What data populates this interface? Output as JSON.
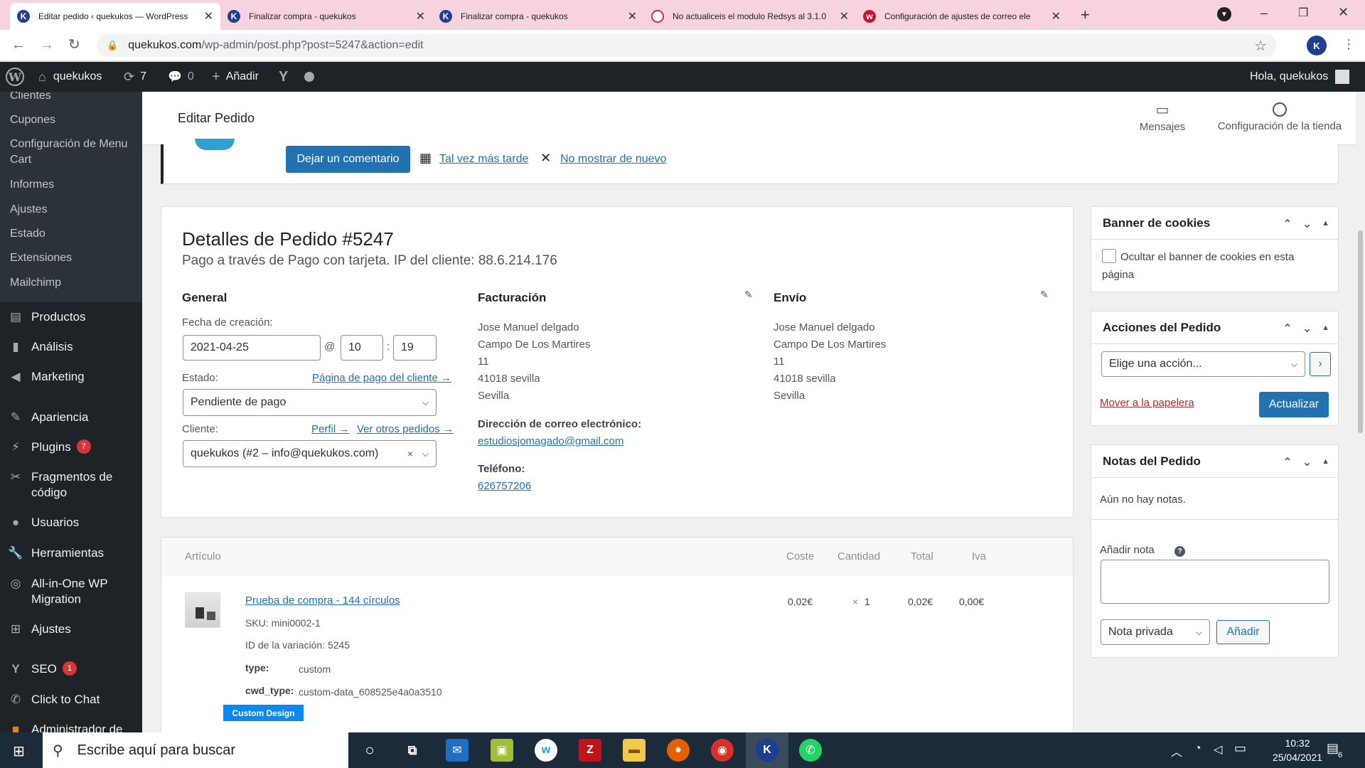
{
  "browser": {
    "tabs": [
      {
        "title": "Editar pedido ‹ quekukos — WordPress",
        "favicon": "K"
      },
      {
        "title": "Finalizar compra - quekukos",
        "favicon": "K"
      },
      {
        "title": "Finalizar compra - quekukos",
        "favicon": "K"
      },
      {
        "title": "No actualiceis el modulo Redsys al 3.1.0",
        "favicon": "R"
      },
      {
        "title": "Configuración de ajustes de correo ele",
        "favicon": "W"
      }
    ],
    "url_host": "quekukos.com",
    "url_path": "/wp-admin/post.php?post=5247&action=edit"
  },
  "adminbar": {
    "site": "quekukos",
    "updates": "7",
    "comments": "0",
    "add": "Añadir",
    "greeting": "Hola, quekukos"
  },
  "sidebar": {
    "sub_items": [
      "Clientes",
      "Cupones",
      "Configuración de Menu Cart",
      "Informes",
      "Ajustes",
      "Estado",
      "Extensiones",
      "Mailchimp"
    ],
    "items": [
      {
        "label": "Productos",
        "icon": "archive-icon"
      },
      {
        "label": "Análisis",
        "icon": "bar-chart-icon"
      },
      {
        "label": "Marketing",
        "icon": "megaphone-icon"
      },
      {
        "label": "Apariencia",
        "icon": "brush-icon"
      },
      {
        "label": "Plugins",
        "icon": "plug-icon",
        "badge": "7"
      },
      {
        "label": "Fragmentos de código",
        "icon": "scissors-icon"
      },
      {
        "label": "Usuarios",
        "icon": "user-icon"
      },
      {
        "label": "Herramientas",
        "icon": "wrench-icon"
      },
      {
        "label": "All-in-One WP Migration",
        "icon": "migration-icon"
      },
      {
        "label": "Ajustes",
        "icon": "settings-icon"
      },
      {
        "label": "SEO",
        "icon": "yoast-icon",
        "badge": "1"
      },
      {
        "label": "Click to Chat",
        "icon": "whatsapp-icon"
      },
      {
        "label": "Administrador de",
        "icon": "folder-icon"
      }
    ]
  },
  "header": {
    "title": "Editar Pedido",
    "messages": "Mensajes",
    "store_setup": "Configuración de la tienda"
  },
  "notice": {
    "comment_button": "Dejar un comentario",
    "later_link": "Tal vez más tarde",
    "dismiss_link": "No mostrar de nuevo"
  },
  "order": {
    "title": "Detalles de Pedido #5247",
    "subtitle": "Pago a través de Pago con tarjeta. IP del cliente: 88.6.214.176",
    "general": {
      "heading": "General",
      "date_label": "Fecha de creación:",
      "date": "2021-04-25",
      "at": "@",
      "hour": "10",
      "colon": ":",
      "minute": "19",
      "status_label": "Estado:",
      "payment_page_link": "Página de pago del cliente →",
      "status": "Pendiente de pago",
      "client_label": "Cliente:",
      "profile_link": "Perfil →",
      "other_orders_link": "Ver otros pedidos →",
      "client": "quekukos (#2 – info@quekukos.com)"
    },
    "billing": {
      "heading": "Facturación",
      "lines": [
        "Jose Manuel delgado",
        "Campo De Los Martires",
        "11",
        "41018 sevilla",
        "Sevilla"
      ],
      "email_label": "Dirección de correo electrónico:",
      "email": "estudiosjomagado@gmail.com",
      "phone_label": "Teléfono:",
      "phone": "626757206"
    },
    "shipping": {
      "heading": "Envío",
      "lines": [
        "Jose Manuel delgado",
        "Campo De Los Martires",
        "11",
        "41018 sevilla",
        "Sevilla"
      ]
    }
  },
  "items": {
    "headers": {
      "item": "Artículo",
      "cost": "Coste",
      "qty": "Cantidad",
      "total": "Total",
      "tax": "Iva"
    },
    "row": {
      "name": "Prueba de compra - 144 círculos",
      "sku": "SKU: mini0002-1",
      "variation": "ID de la variación: 5245",
      "type_label": "type:",
      "type_value": "custom",
      "cwd_label": "cwd_type:",
      "cwd_value": "custom-data_608525e4a0a3510",
      "badge": "Custom Design",
      "cost": "0,02€",
      "qty_x": "×",
      "qty": "1",
      "total": "0,02€",
      "tax": "0,00€"
    }
  },
  "cookies_box": {
    "title": "Banner de cookies",
    "checkbox_label": "Ocultar el banner de cookies en esta página"
  },
  "actions_box": {
    "title": "Acciones del Pedido",
    "select": "Elige una acción...",
    "trash": "Mover a la papelera",
    "update": "Actualizar"
  },
  "notes_box": {
    "title": "Notas del Pedido",
    "empty": "Aún no hay notas.",
    "add_label": "Añadir nota",
    "note_type": "Nota privada",
    "add_button": "Añadir"
  },
  "taskbar": {
    "search_placeholder": "Escribe aquí para buscar",
    "time": "10:32",
    "date": "25/04/2021",
    "notif_count": "6"
  }
}
